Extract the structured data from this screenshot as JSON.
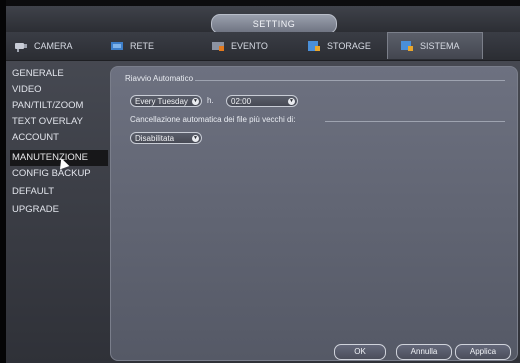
{
  "window": {
    "title": "SETTING"
  },
  "tabs": [
    {
      "label": "CAMERA",
      "icon": "camera-icon"
    },
    {
      "label": "RETE",
      "icon": "network-icon"
    },
    {
      "label": "EVENTO",
      "icon": "event-icon"
    },
    {
      "label": "STORAGE",
      "icon": "storage-icon"
    },
    {
      "label": "SISTEMA",
      "icon": "system-icon",
      "active": true
    }
  ],
  "sidebar": {
    "items": [
      {
        "label": "GENERALE"
      },
      {
        "label": "VIDEO"
      },
      {
        "label": "PAN/TILT/ZOOM"
      },
      {
        "label": "TEXT OVERLAY"
      },
      {
        "label": "ACCOUNT"
      },
      {
        "label": "MANUTENZIONE",
        "active": true
      },
      {
        "label": "CONFIG BACKUP"
      },
      {
        "label": "DEFAULT"
      },
      {
        "label": "UPGRADE"
      }
    ]
  },
  "main": {
    "auto_reboot": {
      "label": "Riavvio Automatico",
      "day_value": "Every Tuesday",
      "hour_label": "h.",
      "time_value": "02:00"
    },
    "delete_old": {
      "label": "Cancellazione automatica dei file più vecchi di:",
      "value": "Disabilitata"
    },
    "buttons": {
      "ok": "OK",
      "cancel": "Annulla",
      "apply": "Applica"
    }
  },
  "colors": {
    "panel": "#60646f",
    "active_tab": "#50545e",
    "sidebar_active_bg": "#171719"
  }
}
